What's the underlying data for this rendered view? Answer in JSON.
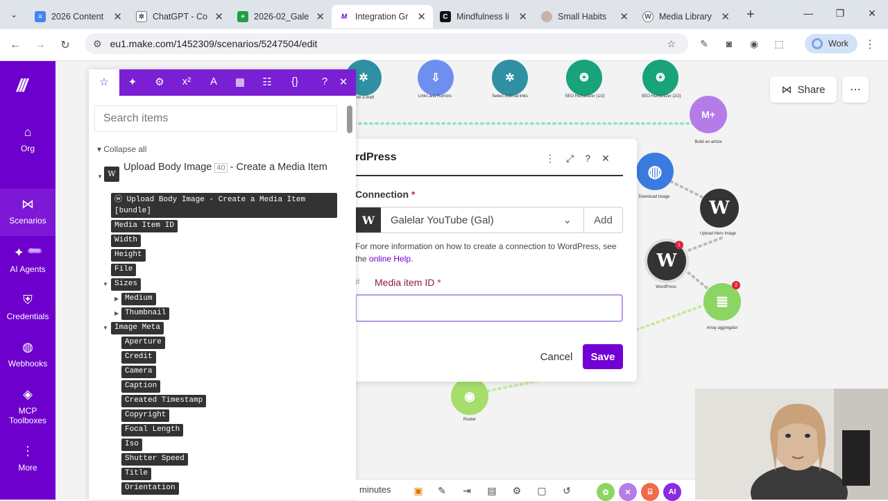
{
  "browser": {
    "tabs": [
      {
        "title": "2026 Content",
        "color": "#4285f4"
      },
      {
        "title": "ChatGPT - Co",
        "color": "#555555"
      },
      {
        "title": "2026-02_Gale",
        "color": "#1e9e4a"
      },
      {
        "title": "Integration Gr",
        "color": "#6d00cc"
      },
      {
        "title": "Mindfulness li",
        "color": "#111111"
      },
      {
        "title": "Small Habits",
        "color": "#c9b0a8"
      },
      {
        "title": "Media Library",
        "color": "#888888"
      }
    ],
    "url": "eu1.make.com/1452309/scenarios/5247504/edit",
    "profile": "Work"
  },
  "sidebar": {
    "items": [
      {
        "label": "Org"
      },
      {
        "label": "Scenarios"
      },
      {
        "label": "AI Agents",
        "badge": "Beta"
      },
      {
        "label": "Credentials"
      },
      {
        "label": "Webhooks"
      },
      {
        "label": "MCP Toolboxes"
      },
      {
        "label": "More"
      }
    ]
  },
  "canvas": {
    "share": "Share",
    "nodes": [
      {
        "label": "Write a draft"
      },
      {
        "label": "Links and Rumors"
      },
      {
        "label": "Select internal links"
      },
      {
        "label": "SEO Humanizer (1/2)"
      },
      {
        "label": "SEO Humanizer (2/2)"
      },
      {
        "label": "Build an article"
      },
      {
        "label": "Download Image"
      },
      {
        "label": "Upload Hero Image"
      },
      {
        "label": "WordPress"
      },
      {
        "label": "Array aggregator"
      },
      {
        "label": "Router"
      }
    ],
    "badges": [
      "1",
      "2"
    ]
  },
  "modal": {
    "title": "rdPress",
    "connection_label": "Connection",
    "connection_value": "Galelar YouTube (Gal)",
    "add": "Add",
    "help_prefix": "For more information on how to create a connection to WordPress, see the ",
    "help_link": "online Help",
    "help_suffix": ".",
    "field_label": "Media item ID",
    "cancel": "Cancel",
    "save": "Save"
  },
  "picker": {
    "search_placeholder": "Search items",
    "collapse": "Collapse all",
    "module_title": "Upload Body Image",
    "module_num": "40",
    "module_rest": " - Create a Media Item",
    "bundle": "Upload Body Image - Create a Media Item [bundle]",
    "items": {
      "media_item_id": "Media Item ID",
      "width": "Width",
      "height": "Height",
      "file": "File",
      "sizes": "Sizes",
      "medium": "Medium",
      "thumbnail": "Thumbnail",
      "image_meta": "Image Meta",
      "aperture": "Aperture",
      "credit": "Credit",
      "camera": "Camera",
      "caption": "Caption",
      "created_timestamp": "Created Timestamp",
      "copyright": "Copyright",
      "focal_length": "Focal Length",
      "iso": "Iso",
      "shutter_speed": "Shutter Speed",
      "title": "Title",
      "orientation": "Orientation"
    }
  },
  "bottombar": {
    "minutes": "minutes",
    "ai": "AI"
  }
}
